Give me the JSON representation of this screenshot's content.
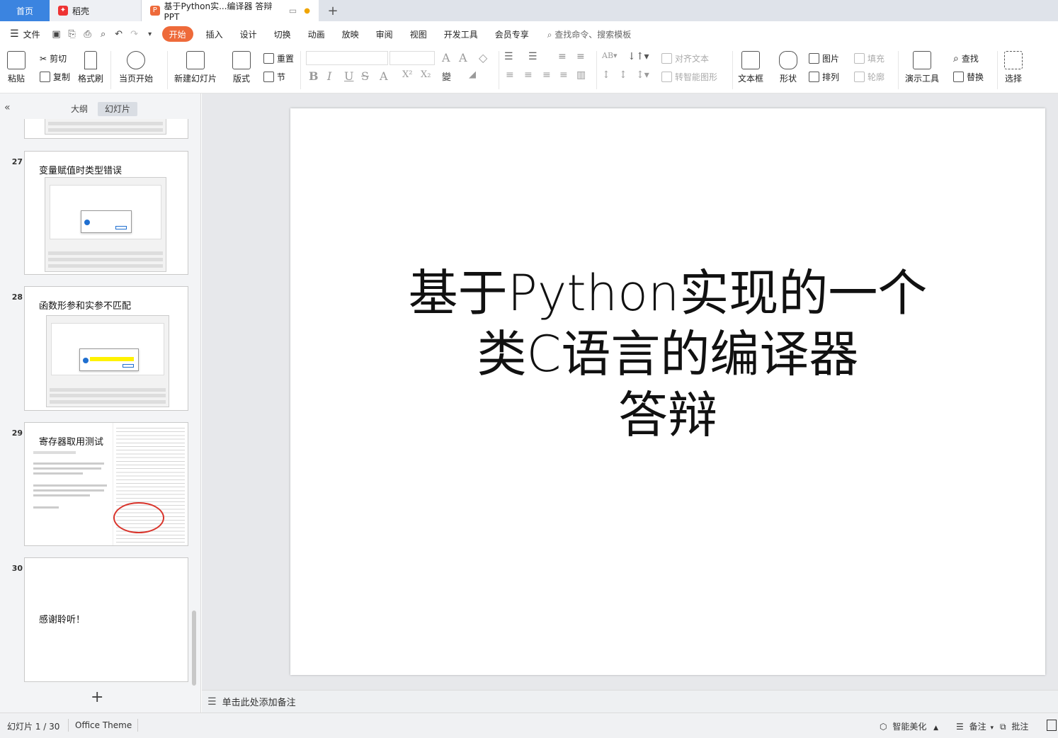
{
  "tabs": {
    "home": "首页",
    "daoke": "稻壳",
    "doc": "基于Python实...编译器 答辩PPT",
    "add": "+"
  },
  "menu": {
    "file": "文件",
    "items": [
      "开始",
      "插入",
      "设计",
      "切换",
      "动画",
      "放映",
      "审阅",
      "视图",
      "开发工具",
      "会员专享"
    ],
    "search": "查找命令、搜索模板"
  },
  "ribbon": {
    "paste": "粘贴",
    "cut": "剪切",
    "copy": "复制",
    "format_painter": "格式刷",
    "from_current": "当页开始",
    "new_slide": "新建幻灯片",
    "layout": "版式",
    "reset": "重置",
    "section": "节",
    "align_text": "对齐文本",
    "smartart": "转智能图形",
    "textbox": "文本框",
    "shape": "形状",
    "picture": "图片",
    "arrange": "排列",
    "fill": "填充",
    "outline": "轮廓",
    "presenter_tools": "演示工具",
    "find": "查找",
    "replace": "替换",
    "select": "选择"
  },
  "panel": {
    "outline_tab": "大纲",
    "slides_tab": "幻灯片",
    "add": "+"
  },
  "thumbnails": [
    {
      "num": "27",
      "title": "变量赋值时类型错误"
    },
    {
      "num": "28",
      "title": "函数形参和实参不匹配"
    },
    {
      "num": "29",
      "title": "寄存器取用测试"
    },
    {
      "num": "30",
      "title": "感谢聆听！"
    }
  ],
  "slide": {
    "title_line1": "基于Python实现的一个",
    "title_line2": "类C语言的编译器",
    "title_line3": "答辩"
  },
  "notes_placeholder": "单击此处添加备注",
  "status": {
    "slide_counter": "幻灯片 1 / 30",
    "theme": "Office Theme",
    "beautify": "智能美化",
    "notes": "备注",
    "comments": "批注"
  },
  "colors": {
    "accent": "#ee6a3a",
    "home_tab": "#3b84e0"
  }
}
